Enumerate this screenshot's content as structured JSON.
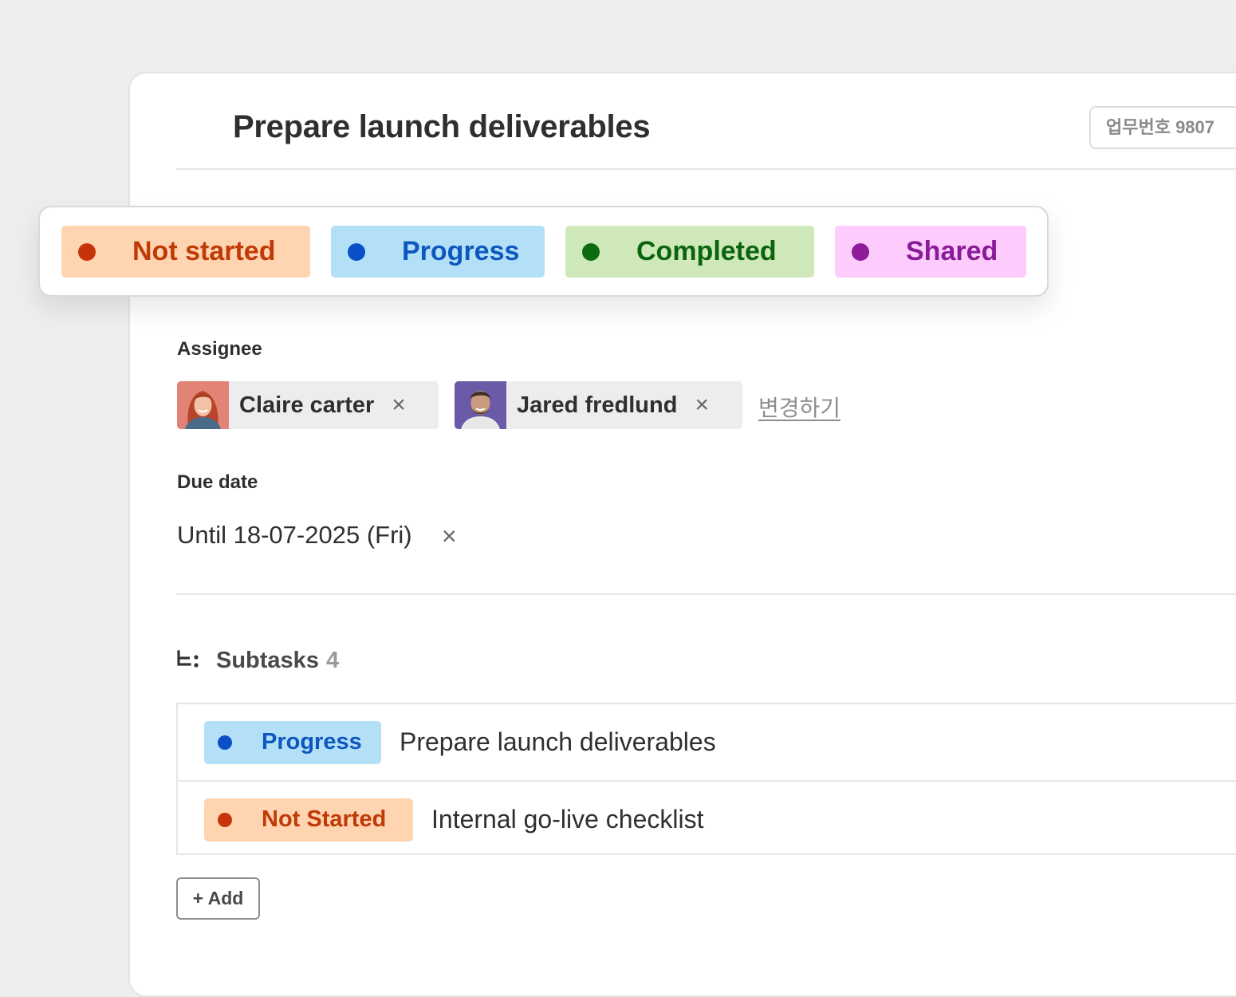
{
  "task": {
    "title": "Prepare launch deliverables",
    "number_label": "업무번호 9807"
  },
  "status_options": [
    {
      "label": "Not started",
      "bg": "#ffd4b0",
      "fg": "#c03a06",
      "dot": "#c8340a"
    },
    {
      "label": "Progress",
      "bg": "#b4e0f7",
      "fg": "#0d57c0",
      "dot": "#0a4fc6"
    },
    {
      "label": "Completed",
      "bg": "#cfe8b9",
      "fg": "#0b650e",
      "dot": "#0c6b10"
    },
    {
      "label": "Shared",
      "bg": "#fdccfd",
      "fg": "#8a1a98",
      "dot": "#8c1c9a"
    }
  ],
  "assignee": {
    "label": "Assignee",
    "people": [
      {
        "name": "Claire carter",
        "remove": "×"
      },
      {
        "name": "Jared fredlund",
        "remove": "×"
      }
    ],
    "change_link": "변경하기"
  },
  "due_date": {
    "label": "Due date",
    "value": "Until 18-07-2025 (Fri)",
    "clear": "×"
  },
  "subtasks": {
    "label": "Subtasks",
    "count": "4",
    "items": [
      {
        "status": "Progress",
        "title": "Prepare launch deliverables",
        "bg": "#b4e0f7",
        "fg": "#0d57c0",
        "dot": "#0a4fc6"
      },
      {
        "status": "Not Started",
        "title": "Internal go-live checklist",
        "bg": "#ffd4b0",
        "fg": "#c03a06",
        "dot": "#c8340a"
      }
    ],
    "add_label": "+ Add"
  }
}
